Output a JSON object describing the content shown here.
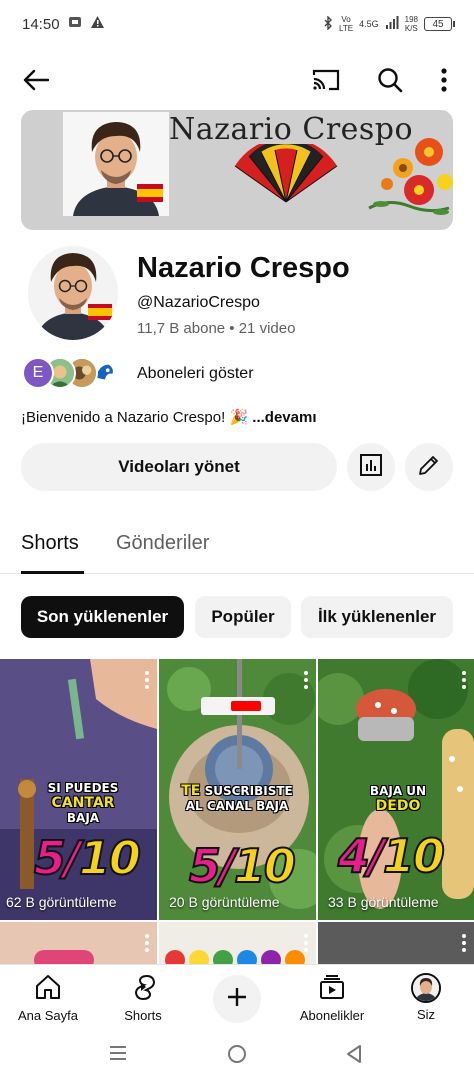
{
  "status_bar": {
    "time": "14:50",
    "net_top": "Vo",
    "net_bottom": "LTE",
    "network": "4.5G",
    "speed_value": "198",
    "speed_unit": "K/S",
    "battery": "45"
  },
  "banner": {
    "title": "Nazario Crespo"
  },
  "channel": {
    "name": "Nazario Crespo",
    "handle": "@NazarioCrespo",
    "stats": "11,7 B abone • 21 video",
    "subscribers_label": "Aboneleri göster",
    "subscriber_initial": "E",
    "description": "¡Bienvenido a Nazario Crespo! 🎉",
    "more_label": "...devamı"
  },
  "actions": {
    "manage_label": "Videoları yönet"
  },
  "tabs": [
    {
      "label": "Shorts"
    },
    {
      "label": "Gönderiler"
    }
  ],
  "chips": [
    {
      "label": "Son yüklenenler"
    },
    {
      "label": "Popüler"
    },
    {
      "label": "İlk yüklenenler"
    }
  ],
  "shorts": [
    {
      "views": "62 B görüntüleme",
      "caption_top": "SI PUEDES",
      "caption_hl": "CANTAR",
      "caption_end": "BAJA",
      "score": "5/",
      "score_max": "10"
    },
    {
      "views": "20 B görüntüleme",
      "caption_top": "SUSCRIBISTE",
      "caption_hl": "TE",
      "caption_end": "AL CANAL BAJA",
      "score": "5/",
      "score_max": "10"
    },
    {
      "views": "33 B görüntüleme",
      "caption_top": "BAJA UN",
      "caption_hl": "DEDO",
      "caption_end": "",
      "score": "4/",
      "score_max": "10"
    }
  ],
  "bottom_nav": [
    {
      "label": "Ana Sayfa",
      "icon": "home-icon"
    },
    {
      "label": "Shorts",
      "icon": "shorts-icon"
    },
    {
      "label": "",
      "icon": "plus-icon"
    },
    {
      "label": "Abonelikler",
      "icon": "subscriptions-icon"
    },
    {
      "label": "Siz",
      "icon": "avatar"
    }
  ],
  "colors": {
    "accent_red": "#ff0000",
    "chip_selected_bg": "#0f0f0f",
    "chip_bg": "#f2f2f2",
    "rating_pink": "#e91e8c",
    "rating_yellow": "#f5d21b"
  }
}
